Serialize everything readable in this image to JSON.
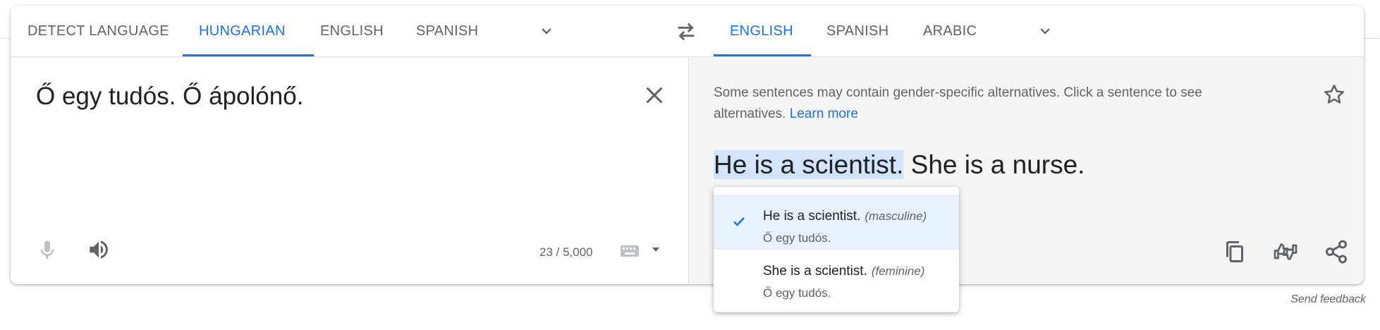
{
  "source_langs": {
    "tabs": [
      "DETECT LANGUAGE",
      "HUNGARIAN",
      "ENGLISH",
      "SPANISH"
    ],
    "active": "HUNGARIAN"
  },
  "target_langs": {
    "tabs": [
      "ENGLISH",
      "SPANISH",
      "ARABIC"
    ],
    "active": "ENGLISH"
  },
  "source": {
    "text": "Ő egy tudós. Ő ápolónő.",
    "char_count": "23 / 5,000"
  },
  "target": {
    "notice": "Some sentences may contain gender-specific alternatives. Click a sentence to see alternatives.",
    "learn_more": "Learn more",
    "sentence_1": "He is a scientist.",
    "sentence_2": "She is a nurse."
  },
  "alternatives": [
    {
      "text": "He is a scientist.",
      "gender": "(masculine)",
      "source": "Ő egy tudós.",
      "selected": true
    },
    {
      "text": "She is a scientist.",
      "gender": "(feminine)",
      "source": "Ő egy tudós.",
      "selected": false
    }
  ],
  "footer": {
    "feedback": "Send feedback"
  },
  "colors": {
    "accent": "#1a73e8",
    "highlight": "#d2e3fc",
    "selected_bg": "#e8f0fe",
    "output_bg": "#f5f5f5"
  }
}
